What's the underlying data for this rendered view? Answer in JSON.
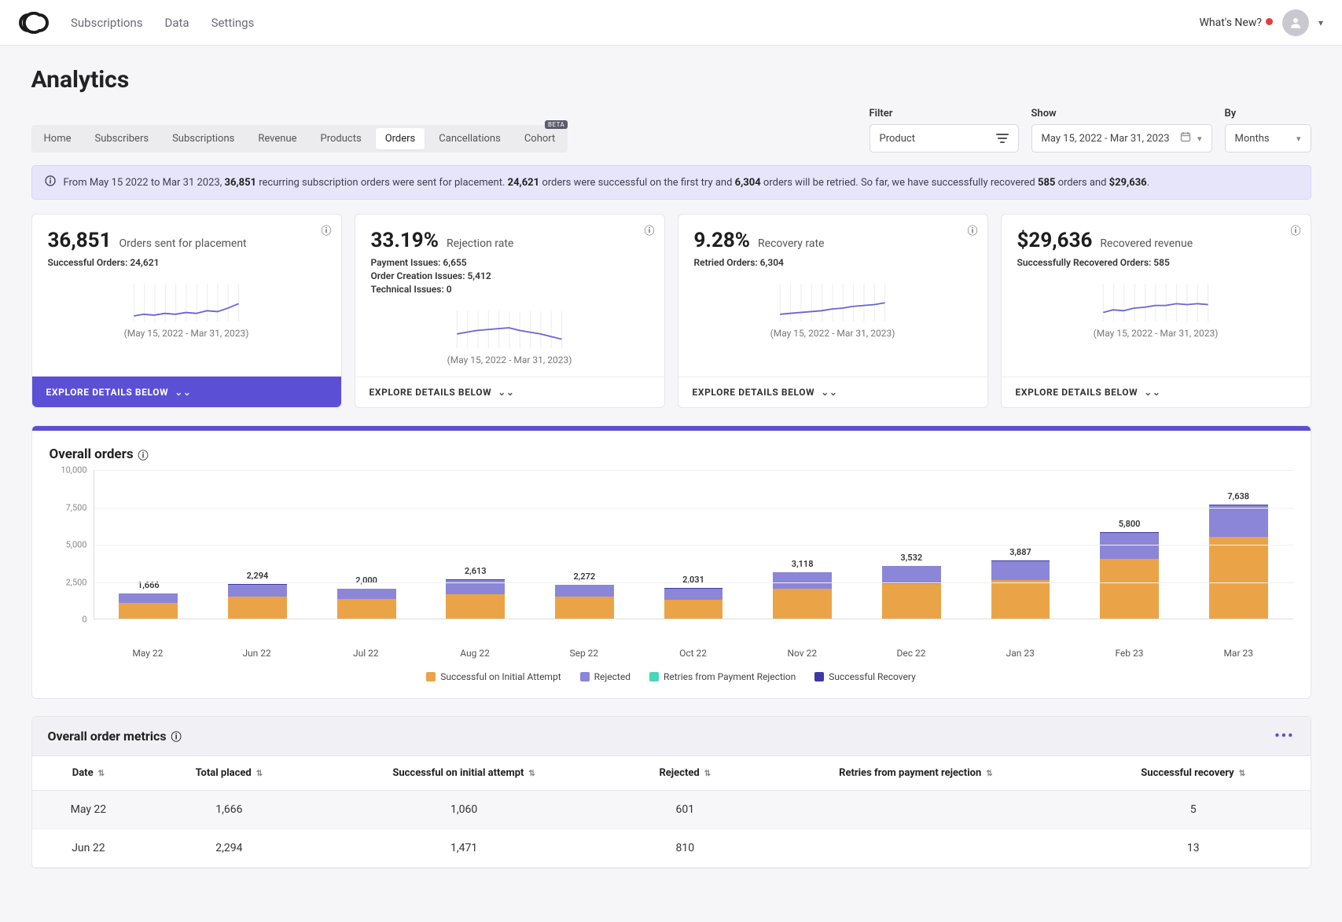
{
  "topnav": {
    "links": [
      "Subscriptions",
      "Data",
      "Settings"
    ],
    "whats_new": "What's New?"
  },
  "page_title": "Analytics",
  "tabs": {
    "items": [
      "Home",
      "Subscribers",
      "Subscriptions",
      "Revenue",
      "Products",
      "Orders",
      "Cancellations",
      "Cohort"
    ],
    "active_index": 5,
    "beta_label": "BETA"
  },
  "filters": {
    "filter_label": "Filter",
    "filter_value": "Product",
    "show_label": "Show",
    "show_value": "May 15, 2022 - Mar 31, 2023",
    "by_label": "By",
    "by_value": "Months"
  },
  "banner": {
    "prefix": "From May 15 2022 to Mar 31 2023, ",
    "b1": "36,851",
    "mid1": " recurring subscription orders were sent for placement. ",
    "b2": "24,621",
    "mid2": " orders were successful on the first try and ",
    "b3": "6,304",
    "mid3": " orders will be retried. So far, we have successfully recovered ",
    "b4": "585",
    "mid4": " orders and ",
    "b5": "$29,636",
    "tail": "."
  },
  "cards": {
    "date_caption": "(May 15, 2022 - Mar 31, 2023)",
    "explore_label": "EXPLORE DETAILS BELOW",
    "items": [
      {
        "value": "36,851",
        "label": "Orders sent for placement",
        "sublines": [
          "Successful Orders: 24,621"
        ]
      },
      {
        "value": "33.19%",
        "label": "Rejection rate",
        "sublines": [
          "Payment Issues: 6,655",
          "Order Creation Issues: 5,412",
          "Technical Issues: 0"
        ]
      },
      {
        "value": "9.28%",
        "label": "Recovery rate",
        "sublines": [
          "Retried Orders: 6,304"
        ]
      },
      {
        "value": "$29,636",
        "label": "Recovered revenue",
        "sublines": [
          "Successfully Recovered Orders: 585"
        ]
      }
    ]
  },
  "orders_chart": {
    "title": "Overall orders"
  },
  "metrics_table": {
    "title": "Overall order metrics",
    "columns": [
      "Date",
      "Total placed",
      "Successful on initial attempt",
      "Rejected",
      "Retries from payment rejection",
      "Successful recovery"
    ],
    "rows": [
      [
        "May 22",
        "1,666",
        "1,060",
        "601",
        "",
        "5"
      ],
      [
        "Jun 22",
        "2,294",
        "1,471",
        "810",
        "",
        "13"
      ]
    ]
  },
  "chart_data": {
    "type": "bar",
    "title": "Overall orders",
    "ylim": [
      0,
      10000
    ],
    "yticks": [
      0,
      2500,
      5000,
      7500,
      10000
    ],
    "categories": [
      "May 22",
      "Jun 22",
      "Jul 22",
      "Aug 22",
      "Sep 22",
      "Oct 22",
      "Nov 22",
      "Dec 22",
      "Jan 23",
      "Feb 23",
      "Mar 23"
    ],
    "totals": [
      1666,
      2294,
      2000,
      2613,
      2272,
      2031,
      3118,
      3532,
      3887,
      5800,
      7638
    ],
    "series": [
      {
        "name": "Successful on Initial Attempt",
        "color": "orange",
        "values": [
          1060,
          1471,
          1300,
          1650,
          1460,
          1270,
          2020,
          2300,
          2560,
          4000,
          5500
        ]
      },
      {
        "name": "Rejected",
        "color": "purple",
        "values": [
          601,
          810,
          690,
          950,
          800,
          750,
          1080,
          1210,
          1300,
          1750,
          2080
        ]
      },
      {
        "name": "Retries from Payment Rejection",
        "color": "teal",
        "values": [
          0,
          0,
          0,
          0,
          0,
          0,
          0,
          0,
          0,
          0,
          0
        ]
      },
      {
        "name": "Successful Recovery",
        "color": "dark",
        "values": [
          5,
          13,
          10,
          13,
          12,
          11,
          18,
          22,
          27,
          50,
          58
        ]
      }
    ],
    "legend": [
      "Successful on Initial Attempt",
      "Rejected",
      "Retries from Payment Rejection",
      "Successful Recovery"
    ]
  }
}
